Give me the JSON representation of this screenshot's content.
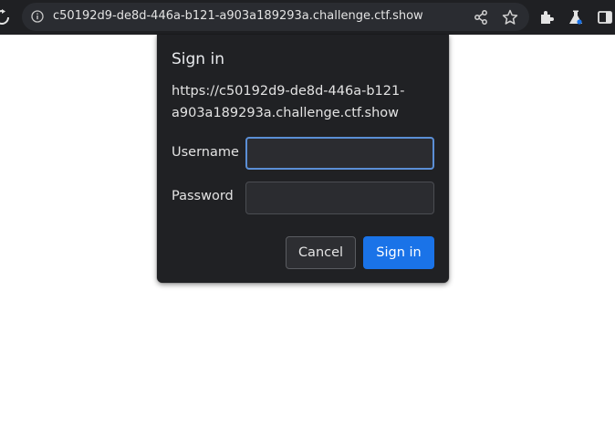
{
  "browser": {
    "url": "c50192d9-de8d-446a-b121-a903a189293a.challenge.ctf.show",
    "icons": [
      "reload-icon",
      "info-icon",
      "share-icon",
      "star-icon",
      "extensions-icon",
      "labs-icon",
      "side-panel-icon"
    ]
  },
  "dialog": {
    "title": "Sign in",
    "origin": "https://c50192d9-de8d-446a-b121-a903a189293a.challenge.ctf.show",
    "username_label": "Username",
    "username_value": "",
    "password_label": "Password",
    "password_value": "",
    "cancel_label": "Cancel",
    "signin_label": "Sign in"
  },
  "colors": {
    "toolbar": "#1f2023",
    "dialog_bg": "#202124",
    "accent": "#1a73e8",
    "focus_border": "#5b8fd6"
  }
}
